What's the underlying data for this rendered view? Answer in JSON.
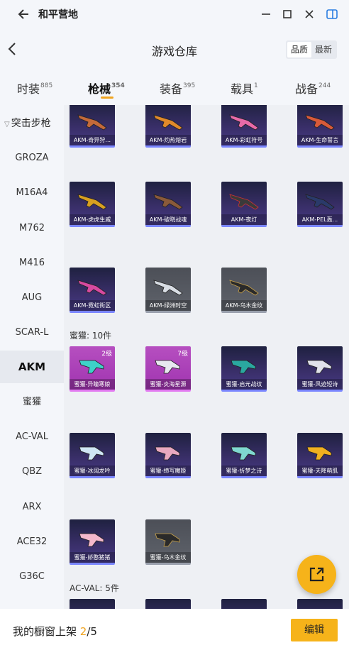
{
  "titlebar": {
    "title": "和平营地"
  },
  "header": {
    "title": "游戏仓库",
    "sort_options": [
      "品质",
      "最新"
    ],
    "sort_active": 0
  },
  "tabs": [
    {
      "label": "时装",
      "count": "885"
    },
    {
      "label": "枪械",
      "count": "354",
      "active": true
    },
    {
      "label": "装备",
      "count": "395"
    },
    {
      "label": "载具",
      "count": "1"
    },
    {
      "label": "战备",
      "count": "244"
    }
  ],
  "sidebar": {
    "category": "突击步枪",
    "items": [
      "GROZA",
      "M16A4",
      "M762",
      "M416",
      "AUG",
      "SCAR-L",
      "AKM",
      "蜜獾",
      "AC-VAL",
      "QBZ",
      "ARX",
      "ACE32",
      "G36C"
    ],
    "active_index": 6
  },
  "grid": {
    "rows": [
      [
        "AKM-奇异狩...",
        "AKM-灼热熔岩",
        "AKM-彩虹符号",
        "AKM-生命誓言"
      ],
      [
        "AKM-虎虎生威",
        "AKM-破晓战魂",
        "AKM-夜灯",
        "AKM-PEL轰..."
      ],
      [
        "AKM-霓虹街区",
        "AKM-绿洲时空",
        "AKM-乌木金纹"
      ],
      [
        "蜜獾-异瞳寒娘",
        "蜜獾-炎海星源",
        "蜜獾-启元战纹",
        "蜜獾-风迹短诗"
      ],
      [
        "蜜獾-冰阔龙吟",
        "蜜獾-缔写魔姬",
        "蜜獾-折梦之诗",
        "蜜獾-天降萌肌"
      ],
      [
        "蜜獾-娇憨猪猪",
        "蜜獾-乌木金纹"
      ]
    ],
    "levels": {
      "3-0": "2级",
      "3-1": "7级"
    },
    "section_badger": "蜜獾: 10件",
    "section_acval": "AC-VAL: 5件"
  },
  "bottom": {
    "label": "我的橱窗上架",
    "current": "2",
    "total": "/5",
    "edit_label": "编辑"
  },
  "colors": {
    "accent": "#f6b31a",
    "card_bg": "#2d2757",
    "card_border": "#7a86ff"
  },
  "icons": [
    "back-arrow-icon",
    "minimize-icon",
    "maximize-icon",
    "close-icon",
    "sidebar-toggle-icon",
    "chevron-left-icon",
    "chevron-down-icon",
    "share-external-icon"
  ]
}
